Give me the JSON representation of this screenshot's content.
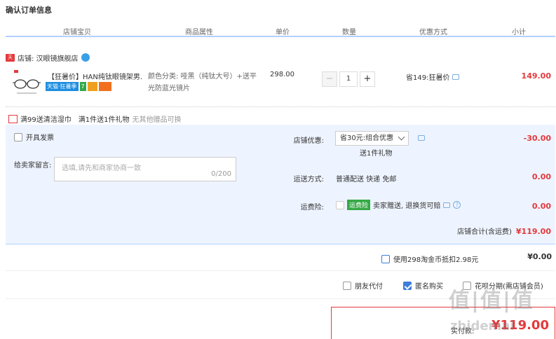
{
  "page": {
    "title": "确认订单信息"
  },
  "columns": [
    "店铺宝贝",
    "商品属性",
    "单价",
    "数量",
    "优惠方式",
    "小计"
  ],
  "shop": {
    "name": "店铺: 汉眼镜旗舰店"
  },
  "item": {
    "title": "【狂暑价】HAN纯钛眼镜架男...",
    "promo_tmall": "天猫·狂暑季",
    "promo_7": "7",
    "attributes": "颜色分类: 哑黑（纯钛大号）+送平光防蓝光镜片",
    "unit_price": "298.00",
    "quantity": "1",
    "minus": "−",
    "plus": "+",
    "discount": "省149:狂暑价",
    "subtotal": "149.00"
  },
  "gift": {
    "label1": "满99送清洁湿巾",
    "label2": "满1件送1件礼物",
    "muted": "无其他赠品可换"
  },
  "panel": {
    "invoice_label": "开具发票",
    "message_label": "给卖家留言:",
    "message_placeholder": "选填,请先和商家协商一致",
    "message_count": "0/200",
    "shop_discount_label": "店铺优惠:",
    "shop_discount_value": "省30元:组合优惠",
    "shop_discount_sub": "送1件礼物",
    "shop_discount_amount": "-30.00",
    "shipping_label": "运送方式:",
    "shipping_value": "普通配送 快递 免邮",
    "shipping_amount": "0.00",
    "insurance_label": "运费险:",
    "insurance_badge": "运费险",
    "insurance_text": "卖家赠送, 退换货可赔",
    "insurance_amount": "0.00",
    "shop_total_label": "店铺合计(含运费)",
    "shop_total_amount": "¥119.00"
  },
  "coins": {
    "label": "使用298淘金币抵扣2.98元",
    "amount": "¥0.00"
  },
  "options": {
    "friend_pay": "朋友代付",
    "anonymous": "匿名购买",
    "huabei": "花呗分期(需店铺会员)"
  },
  "final": {
    "label": "实付款:",
    "amount": "¥119.00"
  },
  "watermark": {
    "text": "值|值|值",
    "site": "zhidemai"
  },
  "colors": {
    "accent": "#e4393c",
    "panel": "#eef4ff",
    "border": "#b2d1ff",
    "link": "#3d7ddb"
  }
}
